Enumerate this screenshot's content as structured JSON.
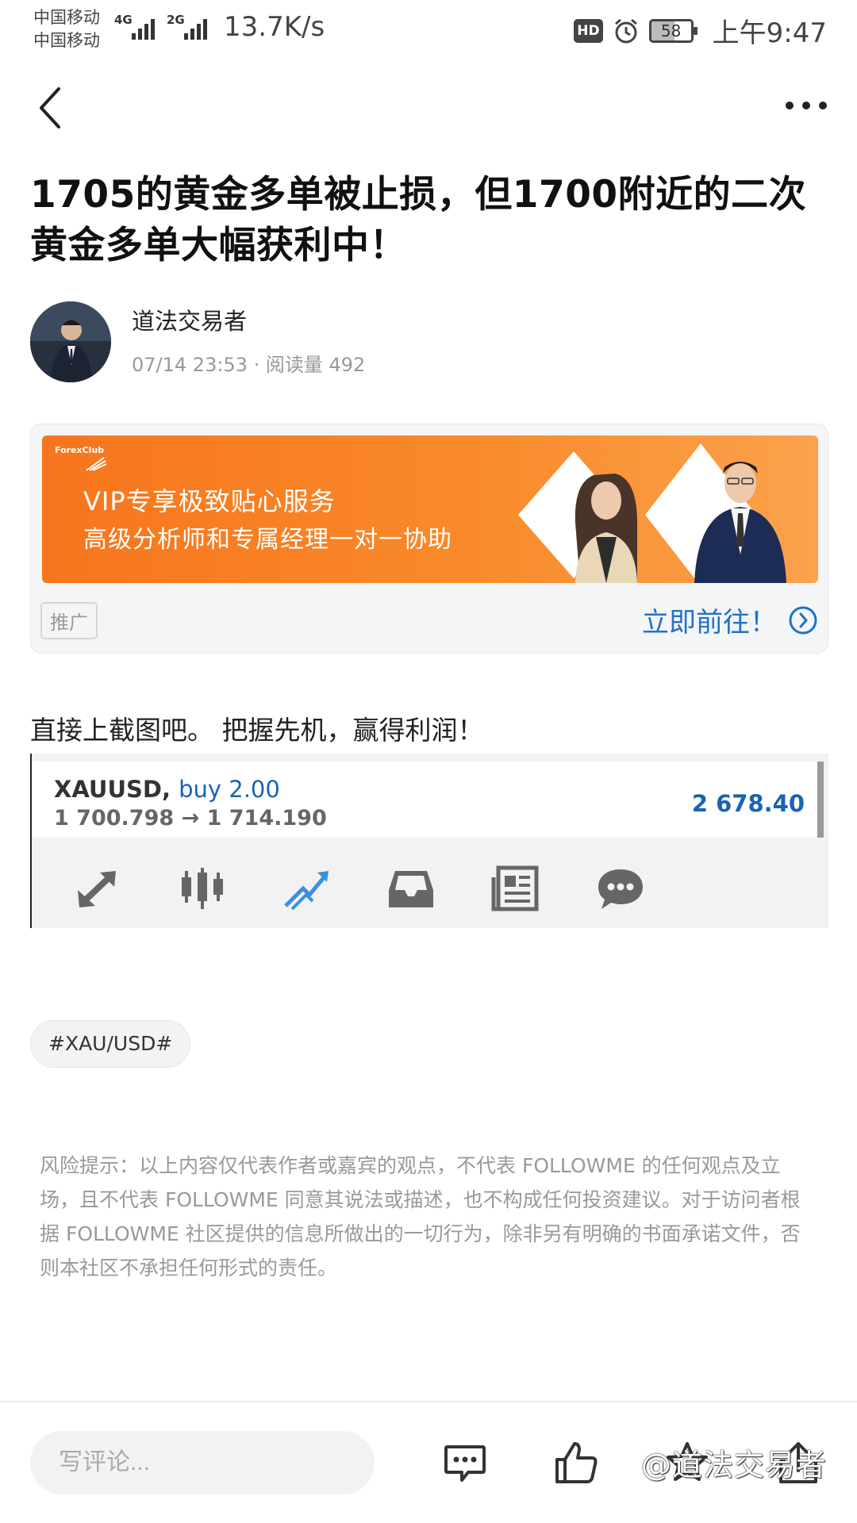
{
  "status_bar": {
    "carrier_1": "中国移动",
    "carrier_2": "中国移动",
    "sim1_gen": "4G",
    "sim2_gen": "2G",
    "net_speed": "13.7K/s",
    "hd": "HD",
    "battery": "58",
    "time": "上午9:47"
  },
  "nav": {
    "back_icon": "chevron-left-icon",
    "more_icon": "more-dots-icon"
  },
  "article": {
    "title": "1705的黄金多单被止损，但1700附近的二次黄金多单大幅获利中！",
    "author": "道法交易者",
    "meta": "07/14 23:53 · 阅读量 492",
    "body": "直接上截图吧。 把握先机，赢得利润！"
  },
  "ad": {
    "logo": "ForexClub",
    "line1": "VIP专享极致贴心服务",
    "line2": "高级分析师和专属经理一对一协助",
    "tag": "推广",
    "cta": "立即前往！",
    "colors": {
      "banner": "#f7751d",
      "cta": "#1f72c8"
    }
  },
  "screenshot": {
    "symbol": "XAUUSD,",
    "direction": "buy 2.00",
    "prices": "1 700.798 → 1 714.190",
    "profit": "2 678.40",
    "toolbar_icons": [
      "trade-arrows-icon",
      "candlestick-icon",
      "chart-trend-icon",
      "inbox-icon",
      "news-icon",
      "chat-icon"
    ]
  },
  "hashtag": "#XAU/USD#",
  "disclaimer": "风险提示：以上内容仅代表作者或嘉宾的观点，不代表 FOLLOWME 的任何观点及立场，且不代表 FOLLOWME 同意其说法或描述，也不构成任何投资建议。对于访问者根据 FOLLOWME 社区提供的信息所做出的一切行为，除非另有明确的书面承诺文件，否则本社区不承担任何形式的责任。",
  "bottom_bar": {
    "comment_placeholder": "写评论...",
    "icons": [
      "comment-icon",
      "like-icon",
      "favorite-icon",
      "share-icon"
    ],
    "watermark": "@道法交易者"
  }
}
